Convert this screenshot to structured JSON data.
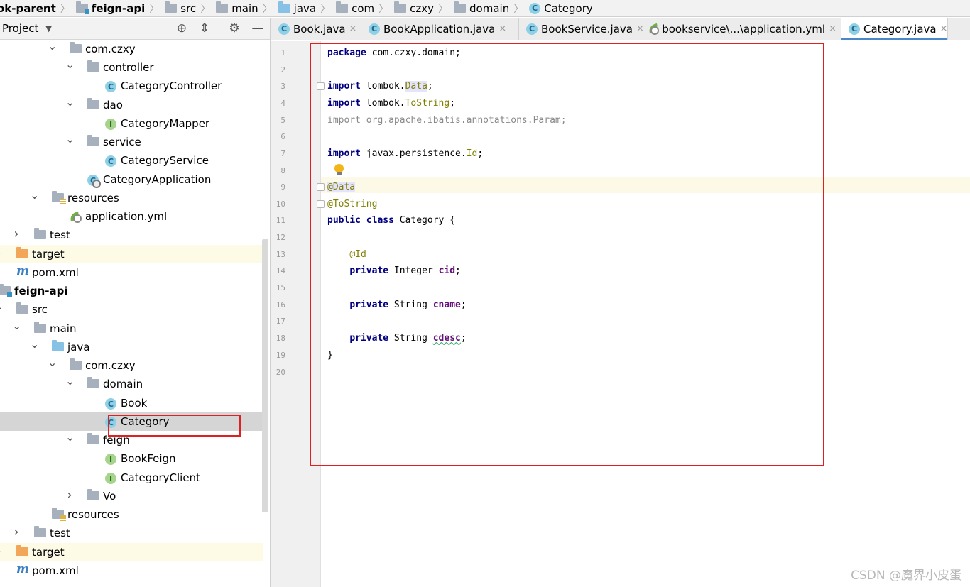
{
  "breadcrumb": {
    "items": [
      {
        "label": "ok-parent",
        "icon": "module-folder-icon",
        "bold": true
      },
      {
        "label": "feign-api",
        "icon": "module-folder-icon",
        "bold": true
      },
      {
        "label": "src",
        "icon": "folder-icon"
      },
      {
        "label": "main",
        "icon": "folder-icon"
      },
      {
        "label": "java",
        "icon": "source-folder-icon"
      },
      {
        "label": "com",
        "icon": "package-icon"
      },
      {
        "label": "czxy",
        "icon": "package-icon"
      },
      {
        "label": "domain",
        "icon": "package-icon"
      },
      {
        "label": "Category",
        "icon": "class-icon"
      }
    ]
  },
  "project_panel": {
    "title": "Project",
    "toolbar_icons": [
      "locate-icon",
      "collapse-icon",
      "gear-icon",
      "minimize-icon"
    ],
    "tree": [
      {
        "label": "com.czxy",
        "icon": "package",
        "expanded": true
      },
      {
        "label": "controller",
        "icon": "package",
        "expanded": true
      },
      {
        "label": "CategoryController",
        "icon": "class"
      },
      {
        "label": "dao",
        "icon": "package",
        "expanded": true
      },
      {
        "label": "CategoryMapper",
        "icon": "interface"
      },
      {
        "label": "service",
        "icon": "package",
        "expanded": true
      },
      {
        "label": "CategoryService",
        "icon": "class"
      },
      {
        "label": "CategoryApplication",
        "icon": "app-class"
      },
      {
        "label": "resources",
        "icon": "resources",
        "expanded": true
      },
      {
        "label": "application.yml",
        "icon": "yml"
      },
      {
        "label": "test",
        "icon": "folder",
        "expanded": false
      },
      {
        "label": "target",
        "icon": "target-folder",
        "expanded": false
      },
      {
        "label": "pom.xml",
        "icon": "maven"
      },
      {
        "label": "feign-api",
        "icon": "module",
        "expanded": true,
        "bold": true
      },
      {
        "label": "src",
        "icon": "folder",
        "expanded": true
      },
      {
        "label": "main",
        "icon": "folder",
        "expanded": true
      },
      {
        "label": "java",
        "icon": "source-folder",
        "expanded": true
      },
      {
        "label": "com.czxy",
        "icon": "package",
        "expanded": true
      },
      {
        "label": "domain",
        "icon": "package",
        "expanded": true
      },
      {
        "label": "Book",
        "icon": "class"
      },
      {
        "label": "Category",
        "icon": "class",
        "selected": true
      },
      {
        "label": "feign",
        "icon": "package",
        "expanded": true
      },
      {
        "label": "BookFeign",
        "icon": "interface"
      },
      {
        "label": "CategoryClient",
        "icon": "interface"
      },
      {
        "label": "Vo",
        "icon": "package",
        "expanded": false
      },
      {
        "label": "resources",
        "icon": "resources"
      },
      {
        "label": "test",
        "icon": "folder",
        "expanded": false
      },
      {
        "label": "target",
        "icon": "target-folder",
        "expanded": false
      },
      {
        "label": "pom.xml",
        "icon": "maven"
      }
    ]
  },
  "tabs": [
    {
      "label": "Book.java",
      "icon": "class-icon"
    },
    {
      "label": "BookApplication.java",
      "icon": "class-icon"
    },
    {
      "label": "BookService.java",
      "icon": "class-icon"
    },
    {
      "label": "bookservice\\...\\application.yml",
      "icon": "yml-icon"
    },
    {
      "label": "Category.java",
      "icon": "class-icon",
      "active": true
    }
  ],
  "editor": {
    "line_numbers": [
      "1",
      "2",
      "3",
      "4",
      "5",
      "6",
      "7",
      "8",
      "9",
      "10",
      "11",
      "12",
      "13",
      "14",
      "15",
      "16",
      "17",
      "18",
      "19",
      "20"
    ],
    "lines": [
      {
        "n": 1,
        "tokens": [
          [
            "kw",
            "package"
          ],
          [
            "",
            " com.czxy.domain;"
          ]
        ]
      },
      {
        "n": 2,
        "tokens": []
      },
      {
        "n": 3,
        "tokens": [
          [
            "kw",
            "import"
          ],
          [
            "",
            " lombok."
          ],
          [
            "imp-sym hl-box",
            "Data"
          ],
          [
            "",
            ";"
          ]
        ]
      },
      {
        "n": 4,
        "tokens": [
          [
            "kw",
            "import"
          ],
          [
            "",
            " lombok."
          ],
          [
            "imp-sym",
            "ToString"
          ],
          [
            "",
            ";"
          ]
        ]
      },
      {
        "n": 5,
        "tokens": [
          [
            "greyed",
            "import org.apache.ibatis.annotations.Param;"
          ]
        ]
      },
      {
        "n": 6,
        "tokens": []
      },
      {
        "n": 7,
        "tokens": [
          [
            "kw",
            "import"
          ],
          [
            "",
            " javax.persistence."
          ],
          [
            "imp-sym",
            "Id"
          ],
          [
            "",
            ";"
          ]
        ]
      },
      {
        "n": 8,
        "tokens": []
      },
      {
        "n": 9,
        "tokens": [
          [
            "ann hl-box",
            "@Data"
          ]
        ]
      },
      {
        "n": 10,
        "tokens": [
          [
            "ann",
            "@ToString"
          ]
        ]
      },
      {
        "n": 11,
        "tokens": [
          [
            "kw",
            "public class"
          ],
          [
            "",
            " Category {"
          ]
        ]
      },
      {
        "n": 12,
        "tokens": []
      },
      {
        "n": 13,
        "tokens": [
          [
            "",
            "    "
          ],
          [
            "ann",
            "@Id"
          ]
        ]
      },
      {
        "n": 14,
        "tokens": [
          [
            "",
            "    "
          ],
          [
            "kw",
            "private"
          ],
          [
            "",
            " Integer "
          ],
          [
            "field",
            "cid"
          ],
          [
            "",
            ";"
          ]
        ]
      },
      {
        "n": 15,
        "tokens": []
      },
      {
        "n": 16,
        "tokens": [
          [
            "",
            "    "
          ],
          [
            "kw",
            "private"
          ],
          [
            "",
            " String "
          ],
          [
            "field",
            "cname"
          ],
          [
            "",
            ";"
          ]
        ]
      },
      {
        "n": 17,
        "tokens": []
      },
      {
        "n": 18,
        "tokens": [
          [
            "",
            "    "
          ],
          [
            "kw",
            "private"
          ],
          [
            "",
            " String "
          ],
          [
            "field wavy",
            "cdesc"
          ],
          [
            "",
            ";"
          ]
        ]
      },
      {
        "n": 19,
        "tokens": [
          [
            "",
            "}"
          ]
        ]
      },
      {
        "n": 20,
        "tokens": []
      }
    ]
  },
  "watermark": "CSDN @魔界小皮蛋",
  "colors": {
    "highlight_box": "#e02020",
    "tab_accent": "#4a88c7"
  }
}
